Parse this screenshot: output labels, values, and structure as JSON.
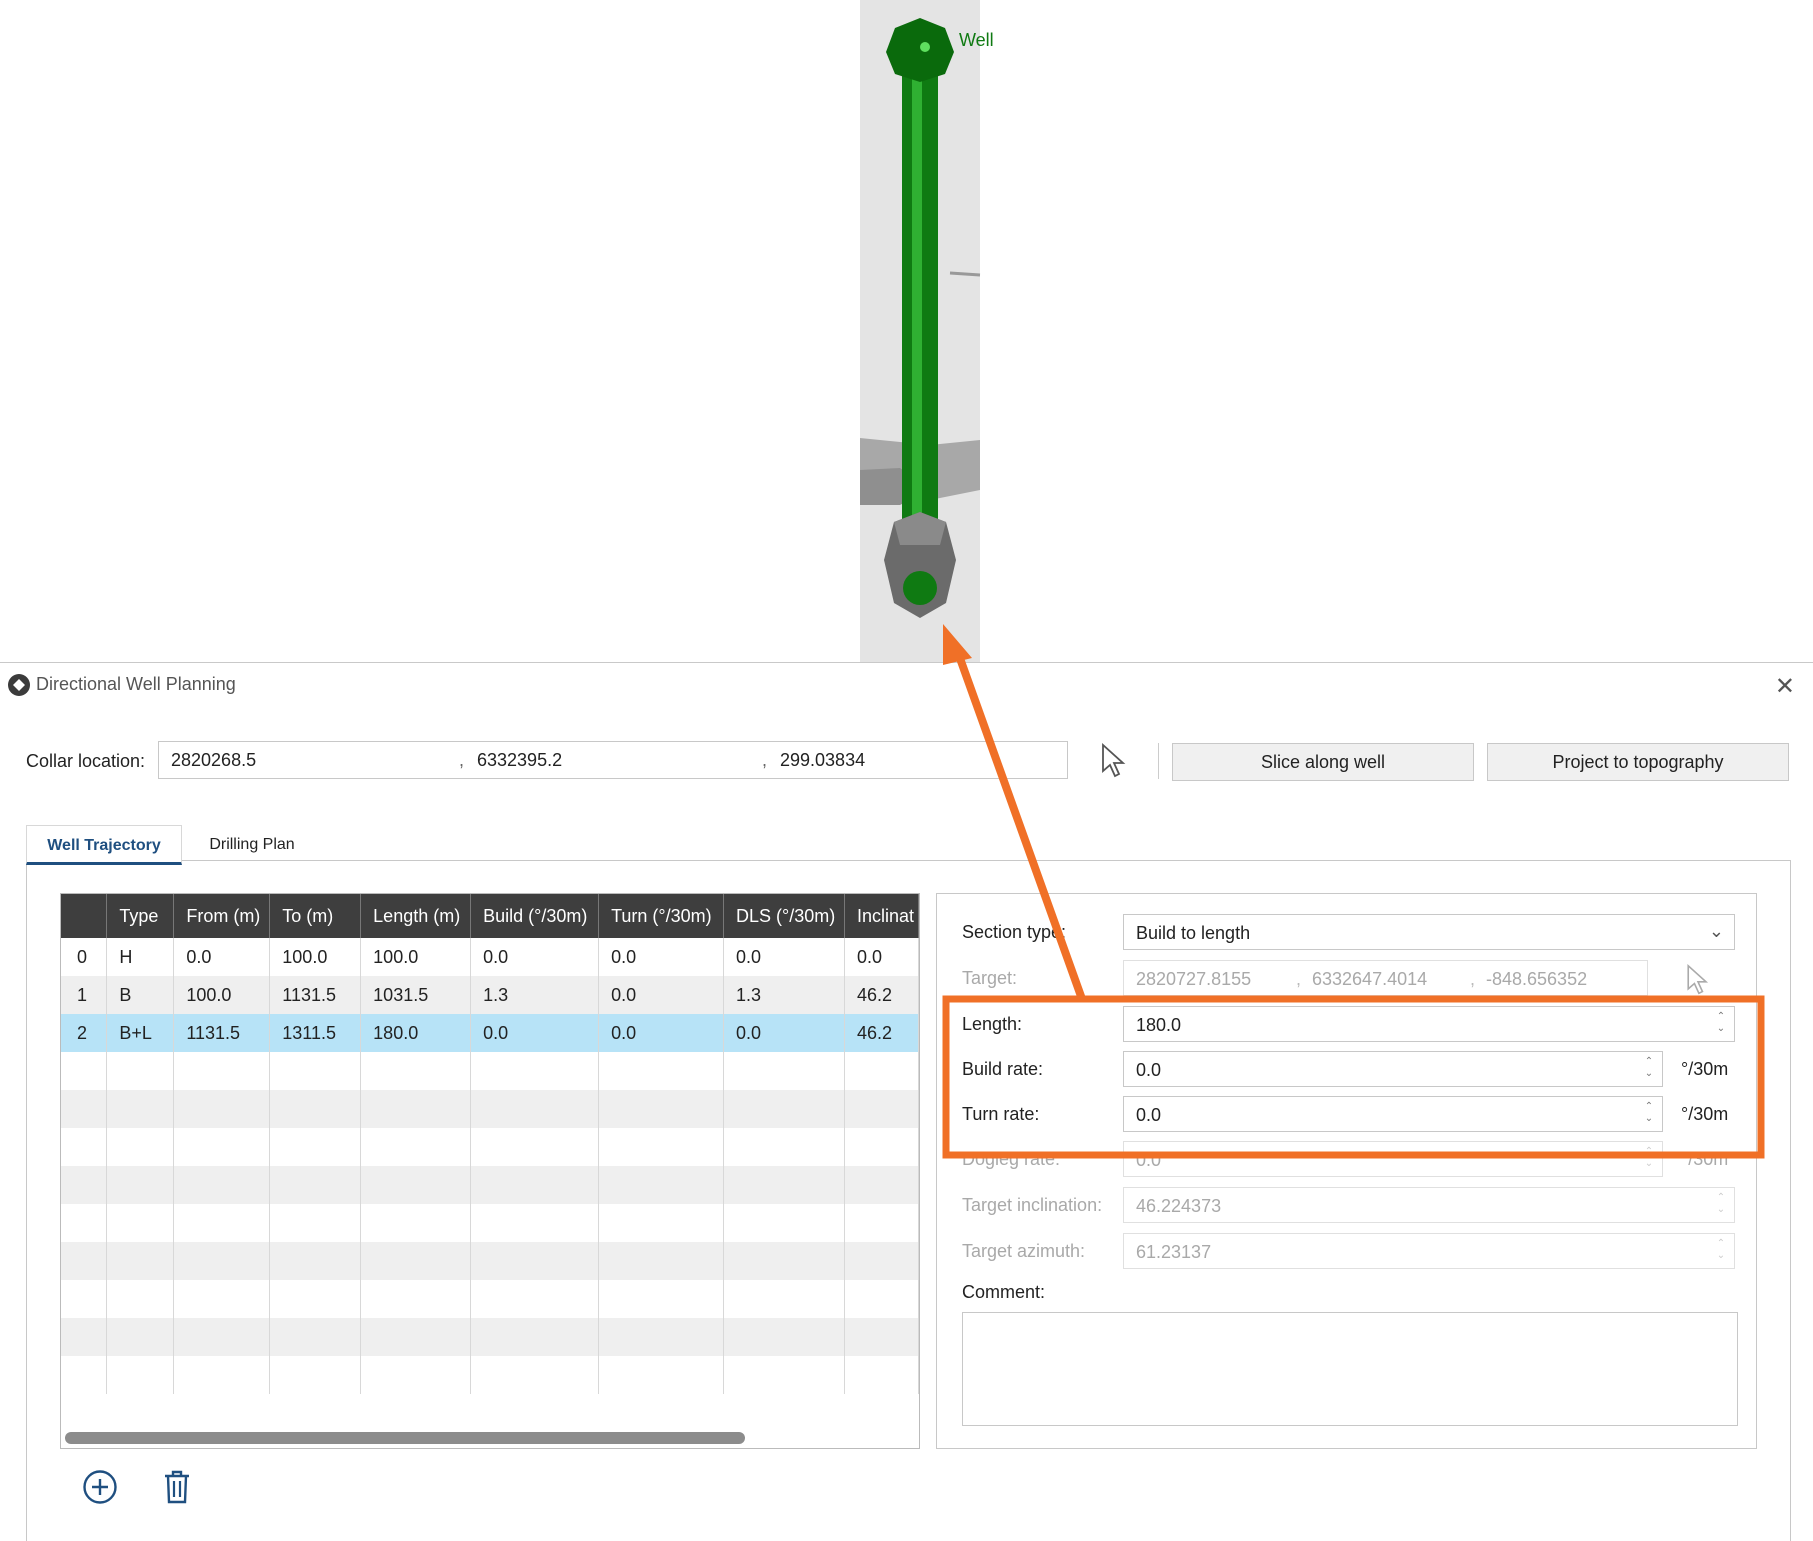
{
  "viewport": {
    "well_label": "Well",
    "colors": {
      "well": "#0f7a12",
      "casing": "#6b6b6b",
      "plane": "#e2e2e2",
      "annotation": "#f07027"
    }
  },
  "dialog": {
    "title": "Directional Well Planning",
    "collar": {
      "label": "Collar location:",
      "x": "2820268.5",
      "y": "6332395.2",
      "z": "299.03834"
    },
    "pick_icon": "cursor-arrow-icon",
    "slice_button": "Slice along well",
    "project_button": "Project to topography",
    "tabs": [
      {
        "label": "Well Trajectory",
        "active": true
      },
      {
        "label": "Drilling Plan",
        "active": false
      }
    ],
    "table": {
      "columns": [
        "",
        "Type",
        "From (m)",
        "To (m)",
        "Length (m)",
        "Build (°/30m)",
        "Turn (°/30m)",
        "DLS (°/30m)",
        "Inclinat"
      ],
      "rows": [
        [
          "0",
          "H",
          "0.0",
          "100.0",
          "100.0",
          "0.0",
          "0.0",
          "0.0",
          "0.0"
        ],
        [
          "1",
          "B",
          "100.0",
          "1131.5",
          "1031.5",
          "1.3",
          "0.0",
          "1.3",
          "46.2"
        ],
        [
          "2",
          "B+L",
          "1131.5",
          "1311.5",
          "180.0",
          "0.0",
          "0.0",
          "0.0",
          "46.2"
        ]
      ],
      "selected_row": 2
    },
    "props": {
      "section_type": {
        "label": "Section type:",
        "value": "Build to length"
      },
      "target": {
        "label": "Target:",
        "x": "2820727.8155",
        "y": "6332647.4014",
        "z": "-848.656352"
      },
      "length": {
        "label": "Length:",
        "value": "180.0"
      },
      "build_rate": {
        "label": "Build rate:",
        "value": "0.0",
        "unit": "°/30m"
      },
      "turn_rate": {
        "label": "Turn rate:",
        "value": "0.0",
        "unit": "°/30m"
      },
      "dogleg_rate": {
        "label": "Dogleg rate:",
        "value": "0.0",
        "unit": "°/30m"
      },
      "target_inclination": {
        "label": "Target inclination:",
        "value": "46.224373"
      },
      "target_azimuth": {
        "label": "Target azimuth:",
        "value": "61.23137"
      },
      "comment": {
        "label": "Comment:",
        "value": ""
      }
    },
    "add_icon": "add-circle-icon",
    "delete_icon": "trash-icon"
  }
}
